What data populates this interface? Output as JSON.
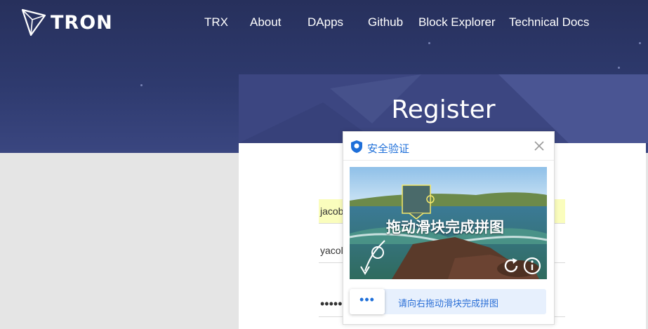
{
  "brand": {
    "name": "TRON"
  },
  "nav": {
    "items": [
      {
        "label": "TRX"
      },
      {
        "label": "About"
      },
      {
        "label": "DApps"
      },
      {
        "label": "Github"
      },
      {
        "label": "Block Explorer"
      },
      {
        "label": "Technical Docs"
      }
    ]
  },
  "page": {
    "title": "Register"
  },
  "form": {
    "field1_value": "jacob",
    "field2_value": "yacol",
    "field3_value": "••••••"
  },
  "captcha": {
    "title": "安全验证",
    "instruction_overlay": "拖动滑块完成拼图",
    "slider_hint": "请向右拖动滑块完成拼图",
    "handle_glyph": "•••"
  },
  "colors": {
    "header_bg": "#2e3a6e",
    "accent_blue": "#1e6fd9",
    "autofill_yellow": "#fafdbd"
  },
  "icons": [
    "tron-logo-icon",
    "shield-icon",
    "close-icon",
    "refresh-icon",
    "info-icon",
    "arrow-icon"
  ]
}
